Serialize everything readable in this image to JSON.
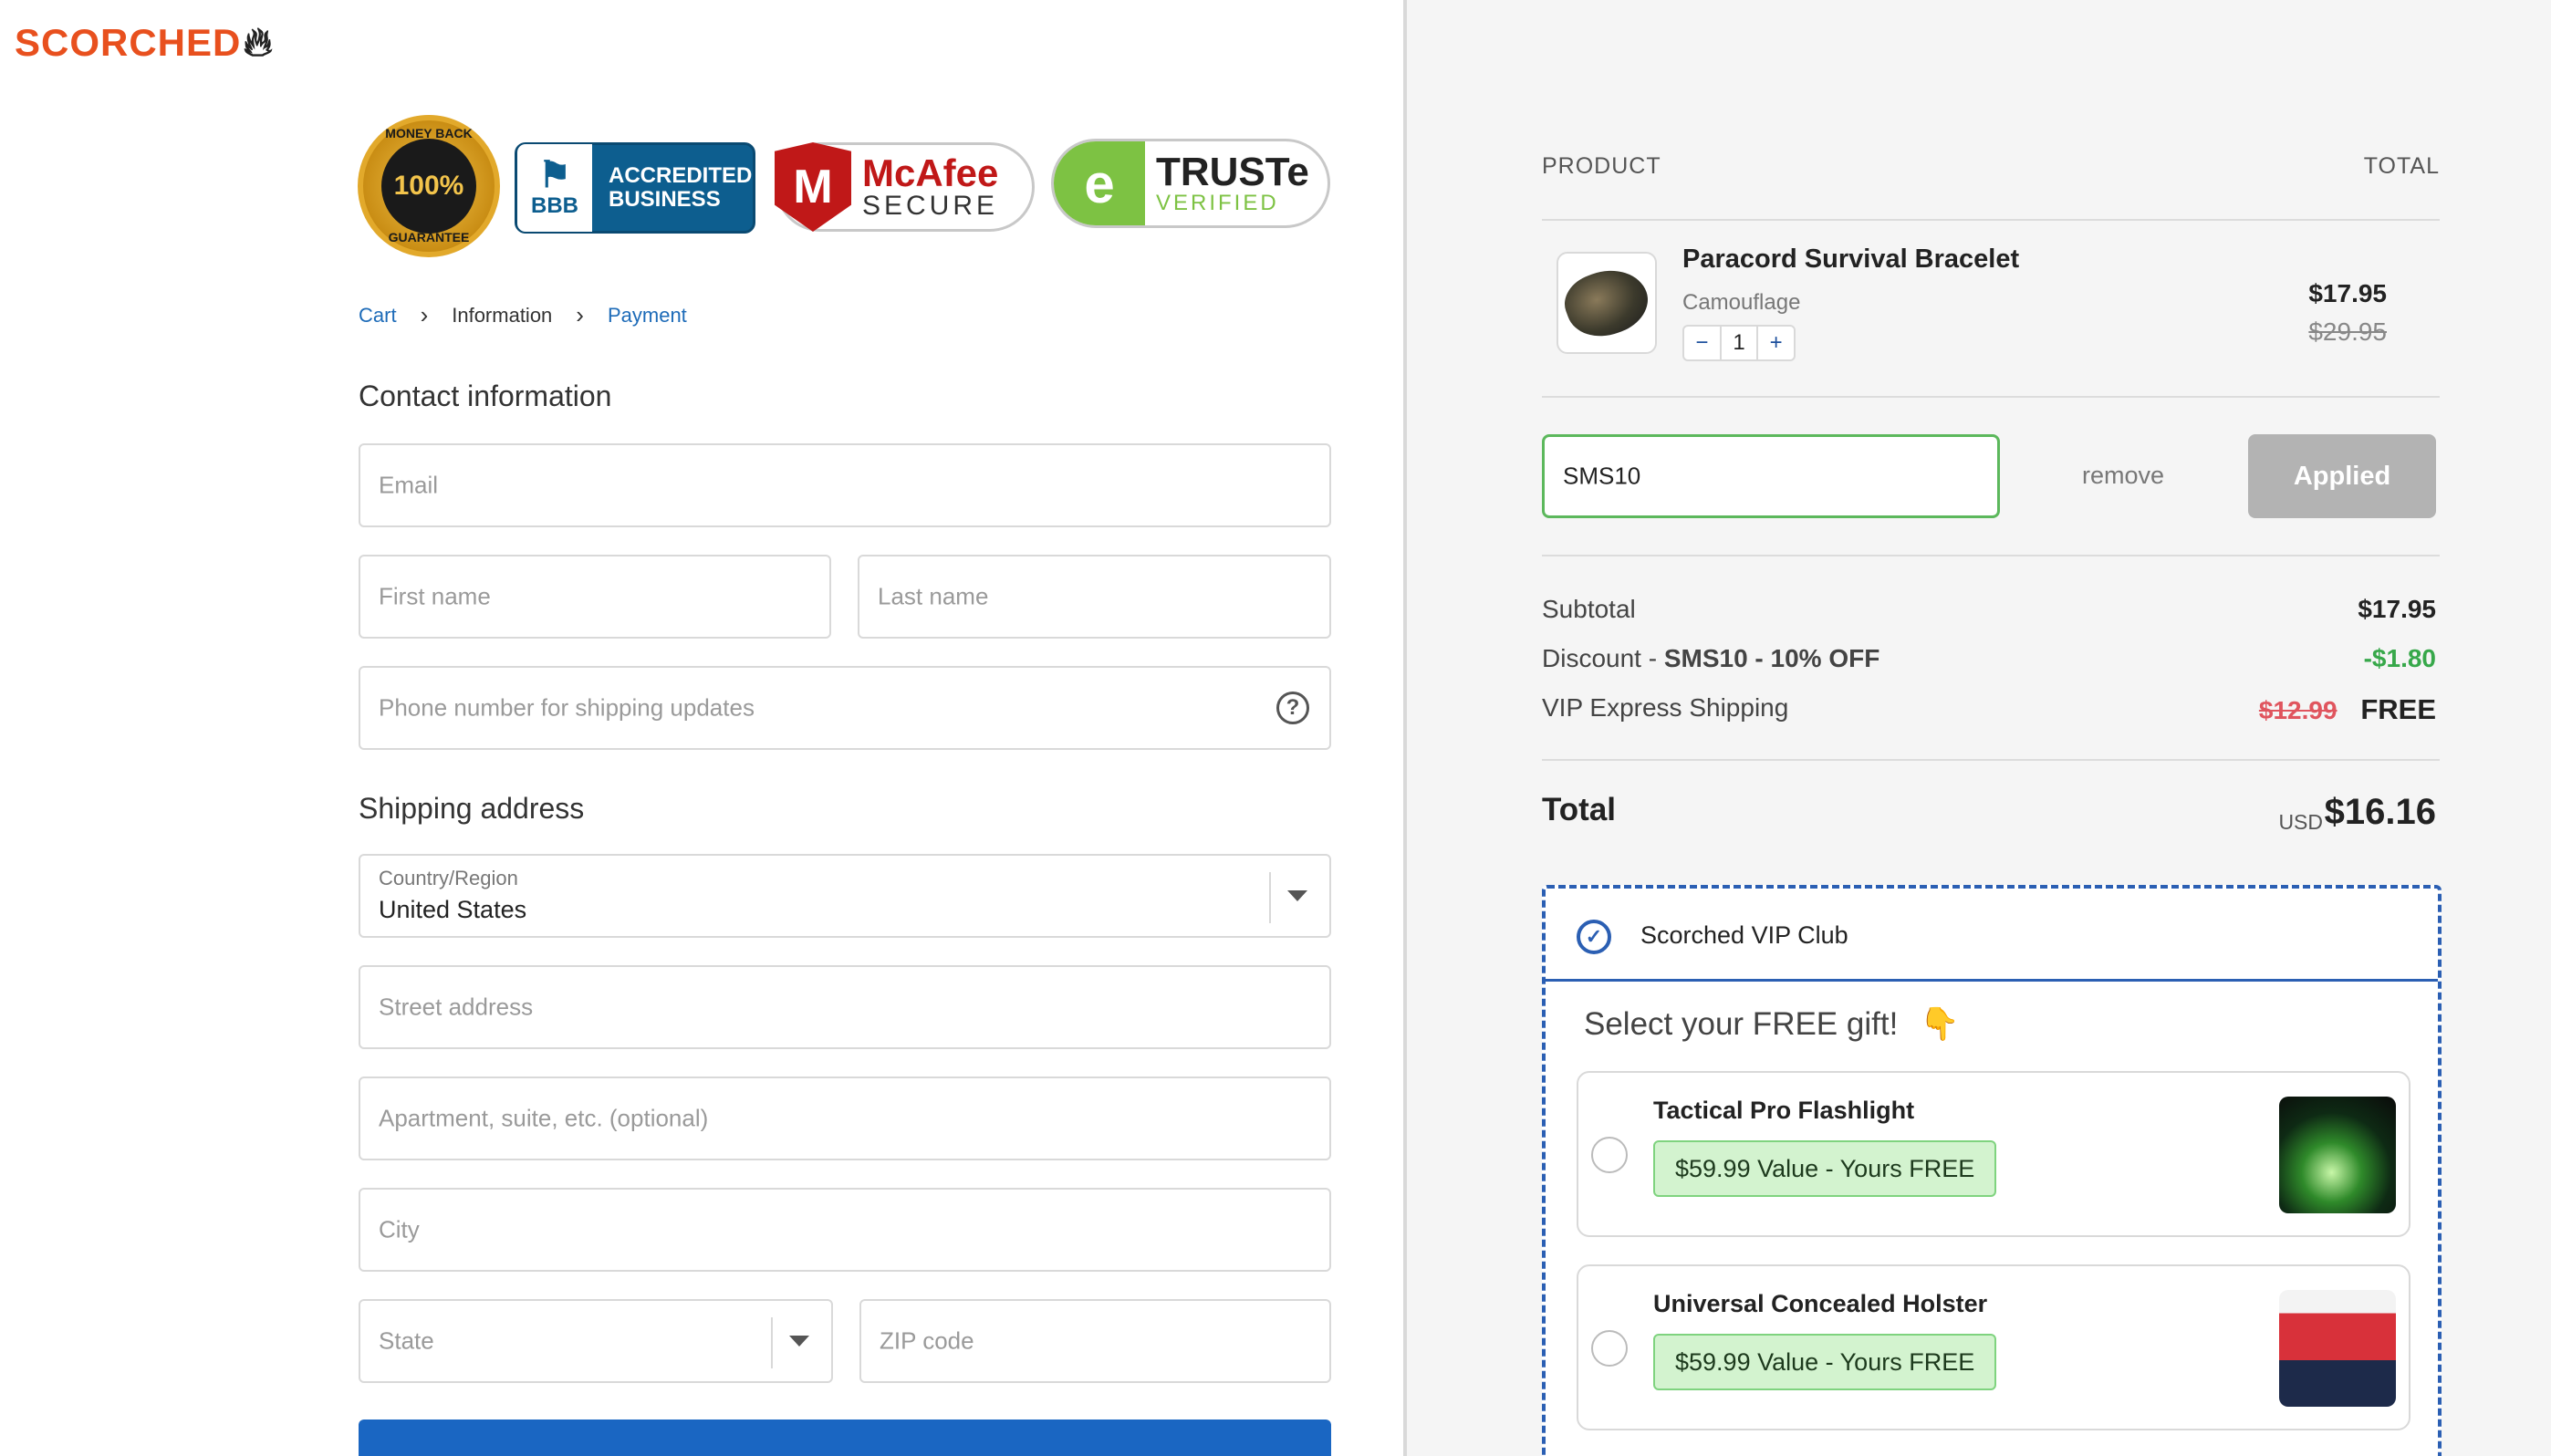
{
  "brand": {
    "name": "SCORCHED",
    "flame_icon": "flame-icon"
  },
  "trust_badges": {
    "money_back": {
      "top": "MONEY BACK",
      "center": "100%",
      "bottom": "GUARANTEE"
    },
    "bbb": {
      "line1": "ACCREDITED",
      "line2": "BUSINESS",
      "logo": "BBB"
    },
    "mcafee": {
      "name": "McAfee",
      "sub": "SECURE"
    },
    "truste": {
      "name": "TRUSTe",
      "sub": "VERIFIED"
    }
  },
  "breadcrumb": {
    "cart": "Cart",
    "information": "Information",
    "payment": "Payment"
  },
  "contact": {
    "title": "Contact information",
    "email_placeholder": "Email",
    "first_name_placeholder": "First name",
    "last_name_placeholder": "Last name",
    "phone_placeholder": "Phone number for shipping updates"
  },
  "shipping": {
    "title": "Shipping address",
    "country_label": "Country/Region",
    "country_value": "United States",
    "street_placeholder": "Street address",
    "apartment_placeholder": "Apartment, suite, etc. (optional)",
    "city_placeholder": "City",
    "state_placeholder": "State",
    "zip_placeholder": "ZIP code"
  },
  "summary": {
    "header_product": "PRODUCT",
    "header_total": "TOTAL",
    "item": {
      "name": "Paracord Survival Bracelet",
      "variant": "Camouflage",
      "quantity": "1",
      "minus": "−",
      "plus": "+",
      "price": "$17.95",
      "compare_price": "$29.95"
    },
    "discount_code": "SMS10",
    "remove_label": "remove",
    "applied_label": "Applied",
    "subtotal_label": "Subtotal",
    "subtotal_value": "$17.95",
    "discount_label_prefix": "Discount - ",
    "discount_code_label": "SMS10 - 10% OFF",
    "discount_value": "-$1.80",
    "shipping_label": "VIP Express Shipping",
    "shipping_old": "$12.99",
    "shipping_value": "FREE",
    "total_label": "Total",
    "currency": "USD",
    "total_value": "$16.16"
  },
  "vip": {
    "title": "Scorched VIP Club",
    "gift_heading": "Select your FREE gift!",
    "gift_emoji": "👇",
    "gifts": [
      {
        "name": "Tactical Pro Flashlight",
        "badge": "$59.99 Value - Yours FREE"
      },
      {
        "name": "Universal Concealed Holster",
        "badge": "$59.99 Value - Yours FREE"
      }
    ]
  },
  "colors": {
    "brand_orange": "#e8501e",
    "link_blue": "#1d6bb8",
    "vip_blue": "#2b5fb3",
    "success_green": "#37a84a",
    "input_focus_green": "#5cb85c",
    "primary_button": "#1a66c2"
  }
}
